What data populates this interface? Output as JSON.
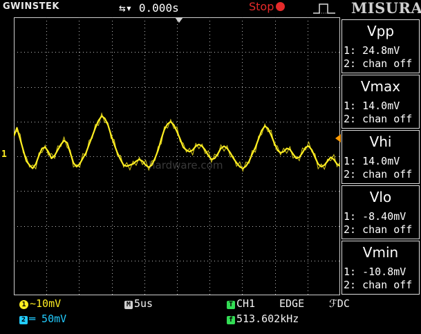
{
  "topbar": {
    "brand": "GWINSTEK",
    "time_position": "0.000s",
    "run_state": "Stop",
    "overlay_logo": "MISURA"
  },
  "measurements": [
    {
      "title": "Vpp",
      "ch1": "1: 24.8mV",
      "ch2": "2: chan off"
    },
    {
      "title": "Vmax",
      "ch1": "1: 14.0mV",
      "ch2": "2: chan off"
    },
    {
      "title": "Vhi",
      "ch1": "1: 14.0mV",
      "ch2": "2: chan off"
    },
    {
      "title": "Vlo",
      "ch1": "1: -8.40mV",
      "ch2": "2: chan off"
    },
    {
      "title": "Vmin",
      "ch1": "1: -10.8mV",
      "ch2": "2: chan off"
    }
  ],
  "status": {
    "ch1_scale": "∼10mV",
    "ch2_scale": "═ 50mV",
    "timebase": "5us",
    "trigger_source": "CH1",
    "trigger_type": "EDGE",
    "trigger_coupling": "DC",
    "frequency": "513.602kHz"
  },
  "watermark": "hardware.com",
  "waveform": {
    "channel_marker": "1",
    "color": "#ffee22",
    "samples": [
      0.3,
      0.45,
      0.25,
      0.05,
      -0.15,
      -0.22,
      -0.28,
      -0.2,
      -0.05,
      0.08,
      0.1,
      0.02,
      -0.1,
      -0.05,
      0.05,
      0.15,
      0.22,
      0.18,
      0.0,
      -0.18,
      -0.25,
      -0.2,
      -0.1,
      0.0,
      0.15,
      0.3,
      0.45,
      0.58,
      0.66,
      0.62,
      0.5,
      0.32,
      0.15,
      0.0,
      -0.12,
      -0.22,
      -0.24,
      -0.22,
      -0.2,
      -0.15,
      -0.12,
      -0.15,
      -0.22,
      -0.26,
      -0.22,
      -0.1,
      0.05,
      0.25,
      0.42,
      0.52,
      0.56,
      0.5,
      0.38,
      0.25,
      0.1,
      0.05,
      0.02,
      0.05,
      0.12,
      0.15,
      0.12,
      0.05,
      -0.05,
      -0.12,
      -0.1,
      -0.02,
      0.08,
      0.12,
      0.08,
      0.0,
      -0.1,
      -0.18,
      -0.25,
      -0.28,
      -0.24,
      -0.15,
      -0.02,
      0.1,
      0.25,
      0.4,
      0.48,
      0.44,
      0.32,
      0.18,
      0.05,
      0.0,
      0.02,
      0.08,
      0.06,
      -0.02,
      -0.1,
      -0.08,
      0.0,
      0.1,
      0.12,
      0.05,
      -0.08,
      -0.2,
      -0.25,
      -0.22,
      -0.15,
      -0.08,
      -0.12,
      -0.2,
      -0.24
    ]
  }
}
